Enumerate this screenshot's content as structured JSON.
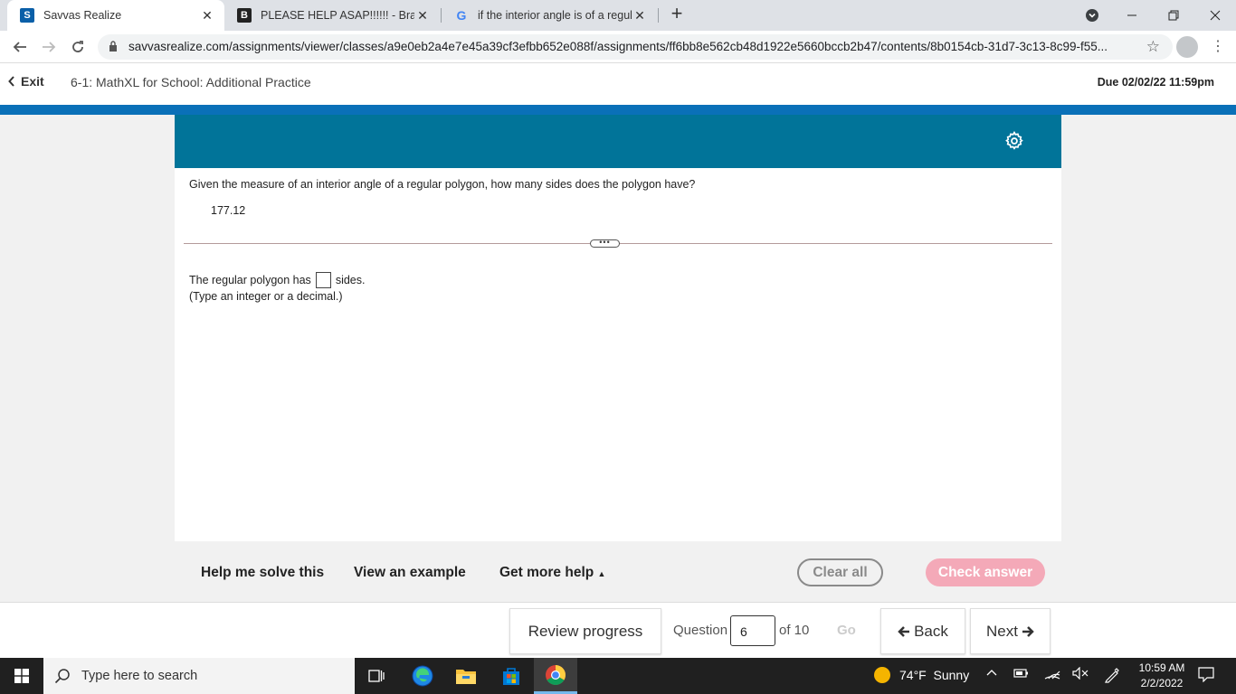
{
  "browser": {
    "tabs": [
      {
        "title": "Savvas Realize",
        "active": true
      },
      {
        "title": "PLEASE HELP ASAP!!!!!! - Brainly.c",
        "active": false
      },
      {
        "title": "if the interior angle is of a regula",
        "active": false
      }
    ],
    "url": "savvasrealize.com/assignments/viewer/classes/a9e0eb2a4e7e45a39cf3efbb652e088f/assignments/ff6bb8e562cb48d1922e5660bccb2b47/contents/8b0154cb-31d7-3c13-8c99-f55..."
  },
  "header": {
    "exit_label": "Exit",
    "assignment_title": "6-1: MathXL for School: Additional Practice",
    "due": "Due 02/02/22 11:59pm"
  },
  "question": {
    "prompt": "Given the measure of an interior angle of a regular polygon, how many sides does the polygon have?",
    "value": "177.12",
    "answer_prefix": "The regular polygon has",
    "answer_suffix": "sides.",
    "hint": "(Type an integer or a decimal.)"
  },
  "helpbar": {
    "help_me_solve": "Help me solve this",
    "view_example": "View an example",
    "get_more_help": "Get more help",
    "clear_all": "Clear all",
    "check_answer": "Check answer"
  },
  "navigation": {
    "review_progress": "Review progress",
    "question_label": "Question",
    "question_number": "6",
    "of_total": "of 10",
    "go": "Go",
    "back": "Back",
    "next": "Next"
  },
  "taskbar": {
    "search_placeholder": "Type here to search",
    "weather": "74°F  Sunny",
    "time": "10:59 AM",
    "date": "2/2/2022"
  },
  "colors": {
    "panel_header": "#017499",
    "accent_strip": "#0a70b8",
    "check_answer_bg": "#f4a9b8"
  }
}
